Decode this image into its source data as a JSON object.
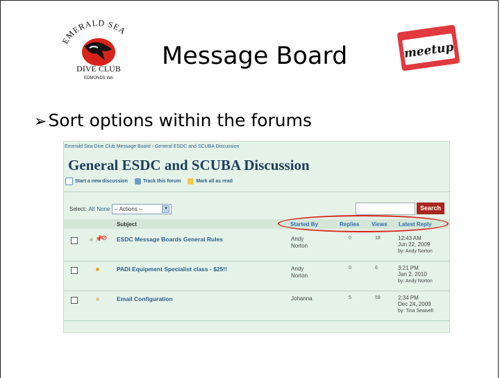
{
  "slide": {
    "title": "Message Board",
    "bullet": "Sort options within the forums",
    "logo_left_text": "EMERALD SEA DIVE CLUB",
    "logo_left_sub": "EDMONDS WA",
    "logo_right_text": "meetup"
  },
  "forum": {
    "breadcrumb_root": "Emerald Sea Dive Club Message Board",
    "breadcrumb_sep": "›",
    "breadcrumb_current": "General ESDC and SCUBA Discussion",
    "title": "General ESDC and SCUBA Discussion",
    "toolbar": {
      "new_discussion": "Start a new discussion",
      "track": "Track this forum",
      "mark_all": "Mark all as read"
    },
    "select": {
      "label": "Select:",
      "all": "All",
      "none": "None",
      "actions": "-- Actions --"
    },
    "search_button": "Search",
    "columns": {
      "subject": "Subject",
      "started_by": "Started By",
      "replies": "Replies",
      "views": "Views",
      "latest_reply": "Latest Reply"
    },
    "rows": [
      {
        "subject": "ESDC Message Boards General Rules",
        "started_by_1": "Andy",
        "started_by_2": "Norton",
        "replies": "0",
        "views": "18",
        "time": "12:43 AM",
        "date": "Jun 22, 2009",
        "by": "by: Andy Norton"
      },
      {
        "subject": "PADI Equipment Specialist class - $25!!",
        "started_by_1": "Andy",
        "started_by_2": "Norton",
        "replies": "0",
        "views": "6",
        "time": "3:21 PM",
        "date": "Jan 2, 2010",
        "by": "by: Andy Norton"
      },
      {
        "subject": "Email Configuration",
        "started_by_1": "Johanna",
        "started_by_2": "",
        "replies": "5",
        "views": "59",
        "time": "2:34 PM",
        "date": "Dec 24, 2009",
        "by": "by: Tina Seawell"
      }
    ]
  },
  "colors": {
    "panel_bg": "#e5f2e8",
    "title_color": "#1e3f5c",
    "link_blue": "#2a5d8c",
    "accent_red": "#d8231a",
    "search_red": "#a8261b"
  }
}
